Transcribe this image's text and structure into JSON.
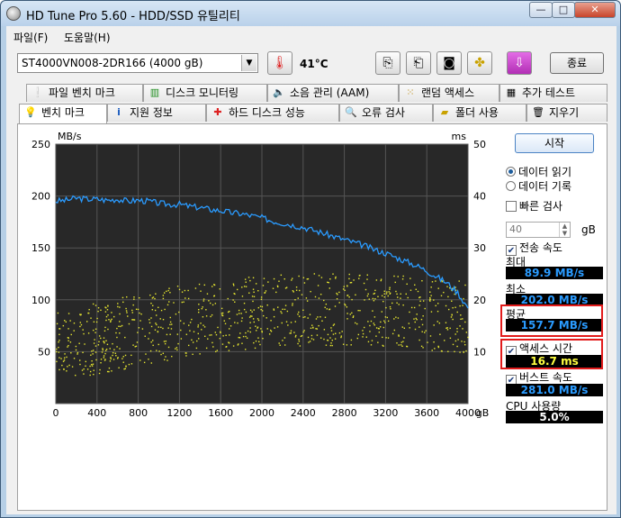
{
  "window": {
    "title": "HD Tune Pro 5.60 - HDD/SSD  유틸리티",
    "min": "—",
    "max": "□",
    "close": "✕"
  },
  "menu": {
    "file": "파일(F)",
    "help": "도움말(H)"
  },
  "toolbar": {
    "drive": "ST4000VN008-2DR166 (4000 gB)",
    "temperature": "41°C",
    "exit": "종료"
  },
  "tabs_row1": [
    "파일 벤치 마크",
    "디스크 모니터링",
    "소음 관리 (AAM)",
    "랜덤 액세스",
    "추가 테스트"
  ],
  "tabs_row2": [
    "벤치 마크",
    "지원 정보",
    "하드 디스크 성능",
    "오류 검사",
    "폴더 사용",
    "지우기"
  ],
  "chart_data": {
    "type": "line",
    "ylabel_left": "MB/s",
    "ylabel_right": "ms",
    "xunit": "gB",
    "x_ticks": [
      "0",
      "400",
      "800",
      "1200",
      "1600",
      "2000",
      "2400",
      "2800",
      "3200",
      "3600",
      "4000"
    ],
    "y_left_ticks": [
      "250",
      "200",
      "150",
      "100",
      "50"
    ],
    "y_right_ticks": [
      "50",
      "40",
      "30",
      "20",
      "10"
    ],
    "xlim": [
      0,
      4000
    ],
    "ylim_left": [
      0,
      250
    ],
    "ylim_right": [
      0,
      50
    ],
    "grid": true,
    "series": [
      {
        "color": "#2a9bff",
        "x": [
          0,
          100,
          200,
          300,
          400,
          500,
          600,
          700,
          800,
          900,
          1000,
          1100,
          1200,
          1300,
          1400,
          1500,
          1600,
          1700,
          1800,
          1900,
          2000,
          2100,
          2200,
          2300,
          2400,
          2500,
          2600,
          2700,
          2800,
          2900,
          3000,
          3100,
          3200,
          3300,
          3400,
          3500,
          3600,
          3700,
          3800,
          3900,
          4000
        ],
        "values": [
          195,
          196,
          198,
          197,
          197,
          196,
          197,
          195,
          196,
          195,
          193,
          192,
          192,
          190,
          189,
          187,
          186,
          184,
          183,
          181,
          179,
          176,
          174,
          172,
          170,
          167,
          164,
          161,
          158,
          155,
          152,
          148,
          145,
          141,
          137,
          133,
          128,
          122,
          116,
          107,
          92
        ]
      }
    ],
    "access_time_scatter": {
      "color": "#e8e830",
      "note": "yellow access time points, ms, spread 8 to 24 with trend rising toward middle"
    }
  },
  "controls": {
    "start": "시작",
    "read": "데이터 읽기",
    "write": "데이터 기록",
    "fast_test": "빠른 검사",
    "spin_value": "40",
    "gb": "gB",
    "transfer_rate": "전송 속도",
    "max_label": "최대",
    "max_value": "89.9 MB/s",
    "min_label": "최소",
    "min_value": "202.0 MB/s",
    "avg_label": "평균",
    "avg_value": "157.7 MB/s",
    "access_label": "액세스 시간",
    "access_value": "16.7 ms",
    "burst_label": "버스트 속도",
    "burst_value": "281.0 MB/s",
    "cpu_label": "CPU 사용량",
    "cpu_value": "5.0%"
  }
}
